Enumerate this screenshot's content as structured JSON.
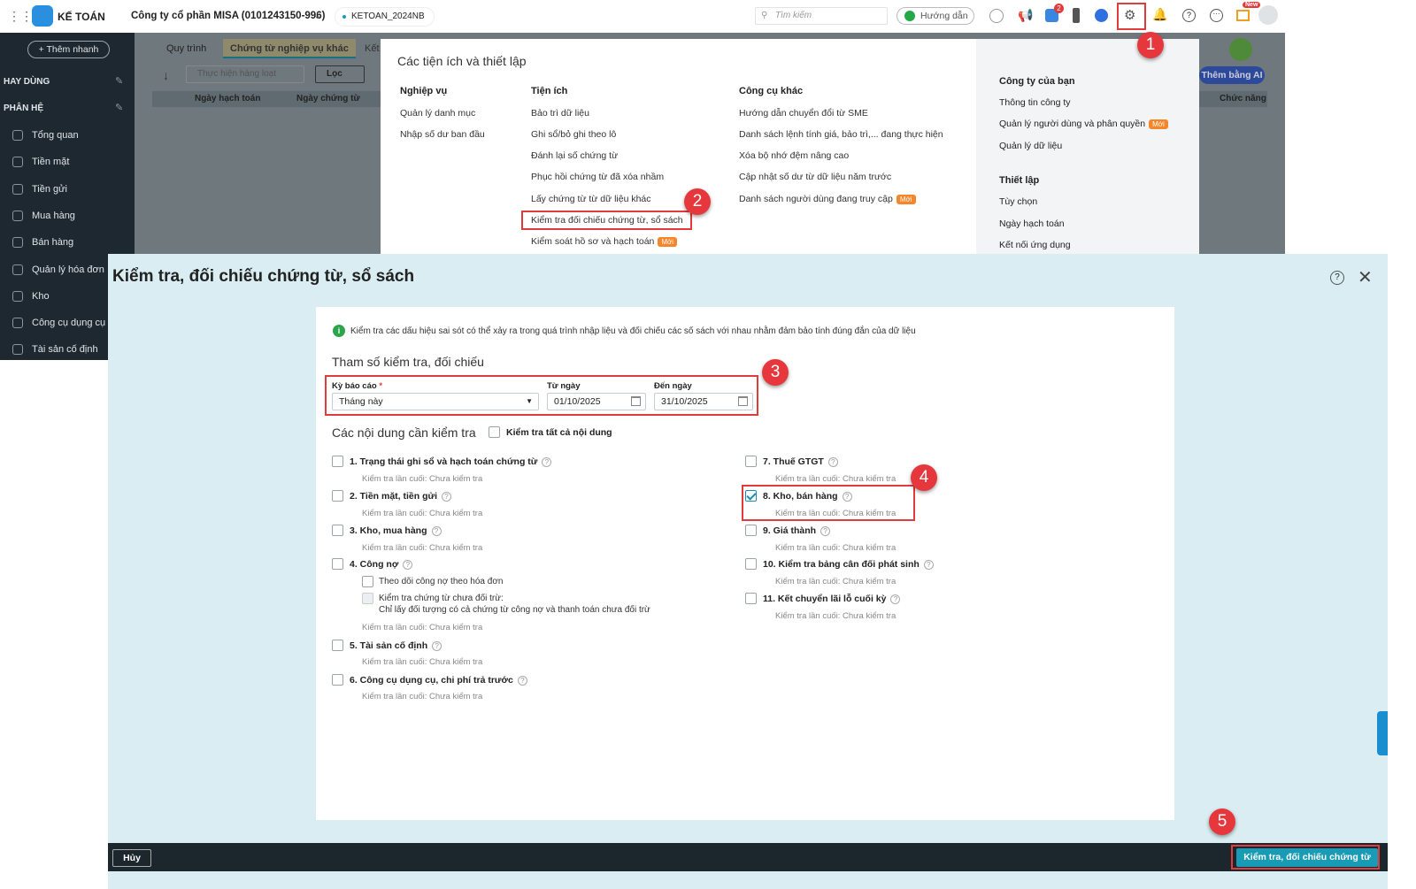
{
  "topbar": {
    "app_name": "KẾ TOÁN",
    "company": "Công ty cổ phần MISA (0101243150-996)",
    "database": "KETOAN_2024NB",
    "search_placeholder": "Tìm kiếm",
    "guide_label": "Hướng dẫn",
    "cart_badge": "2",
    "new_badge": "New"
  },
  "sidebar": {
    "quick_add": "+ Thêm nhanh",
    "section_frequent": "HAY DÙNG",
    "section_modules": "PHÂN HỆ",
    "items": [
      "Tổng quan",
      "Tiền mặt",
      "Tiền gửi",
      "Mua hàng",
      "Bán hàng",
      "Quản lý hóa đơn",
      "Kho",
      "Công cụ dụng cụ",
      "Tài sản cố định"
    ]
  },
  "background": {
    "tabs": [
      "Quy trình",
      "Chứng từ nghiệp vụ khác",
      "Kết"
    ],
    "batch_label": "Thực hiện hàng loạt",
    "filter_label": "Lọc",
    "col_headers": [
      "Ngày hạch toán",
      "Ngày chứng từ",
      "Chức năng"
    ],
    "ai_button": "Thêm bằng AI"
  },
  "menu": {
    "title": "Các tiện ích và thiết lập",
    "columns": [
      {
        "header": "Nghiệp vụ",
        "items": [
          "Quản lý danh mục",
          "Nhập số dư ban đầu"
        ]
      },
      {
        "header": "Tiện ích",
        "items": [
          "Bảo trì dữ liệu",
          "Ghi sổ/bỏ ghi theo lô",
          "Đánh lại số chứng từ",
          "Phục hồi chứng từ đã xóa nhầm",
          "Lấy chứng từ từ dữ liệu khác",
          "Kiểm tra đối chiếu chứng từ, sổ sách",
          "Kiểm soát hồ sơ và hạch toán"
        ]
      },
      {
        "header": "Công cụ khác",
        "items": [
          "Hướng dẫn chuyển đổi từ SME",
          "Danh sách lệnh tính giá, bảo trì,... đang thực hiện",
          "Xóa bộ nhớ đệm nâng cao",
          "Cập nhật số dư từ dữ liệu năm trước",
          "Danh sách người dùng đang truy cập"
        ]
      }
    ],
    "right": {
      "company_header": "Công ty của bạn",
      "company_items": [
        "Thông tin công ty",
        "Quản lý người dùng và phân quyền",
        "Quản lý dữ liệu"
      ],
      "settings_header": "Thiết lập",
      "settings_items": [
        "Tùy chọn",
        "Ngày hạch toán",
        "Kết nối ứng dụng"
      ]
    },
    "new_badge": "Mới"
  },
  "dialog": {
    "title": "Kiểm tra, đối chiếu chứng từ, sổ sách",
    "info": "Kiểm tra các dấu hiệu sai sót có thể xảy ra trong quá trình nhập liệu và đối chiếu các số sách với nhau nhằm đảm bảo tính đúng đắn của dữ liệu",
    "params_title": "Tham số kiểm tra, đối chiếu",
    "period_label": "Kỳ báo cáo",
    "required_mark": "*",
    "period_value": "Tháng này",
    "from_label": "Từ ngày",
    "from_value": "01/10/2025",
    "to_label": "Đến ngày",
    "to_value": "31/10/2025",
    "contents_title": "Các nội dung cần kiểm tra",
    "check_all": "Kiểm tra tất cả nội dung",
    "last_check": "Kiểm tra lần cuối: Chưa kiểm tra",
    "left_items": [
      "1. Trạng thái ghi sổ và hạch toán chứng từ",
      "2. Tiền mặt, tiền gửi",
      "3. Kho, mua hàng",
      "4. Công nợ",
      "5. Tài sản cố định",
      "6. Công cụ dụng cụ, chi phí trả trước"
    ],
    "debt_sub1": "Theo dõi công nợ theo hóa đơn",
    "debt_sub2": "Kiểm tra chứng từ chưa đối trừ:",
    "debt_sub2_note": "Chỉ lấy đối tượng có cả chứng từ công nợ và thanh toán chưa đối trừ",
    "right_items": [
      "7. Thuế GTGT",
      "8. Kho, bán hàng",
      "9. Giá thành",
      "10. Kiểm tra bảng cân đối phát sinh",
      "11. Kết chuyển lãi lỗ cuối kỳ"
    ],
    "checked": [
      "8. Kho, bán hàng"
    ],
    "cancel": "Hủy",
    "submit": "Kiểm tra, đối chiếu chứng từ"
  },
  "steps": [
    "1",
    "2",
    "3",
    "4",
    "5"
  ],
  "colors": {
    "accent": "#1a9bb5",
    "sidebar": "#1e2830",
    "annotation": "#e23b3b"
  }
}
